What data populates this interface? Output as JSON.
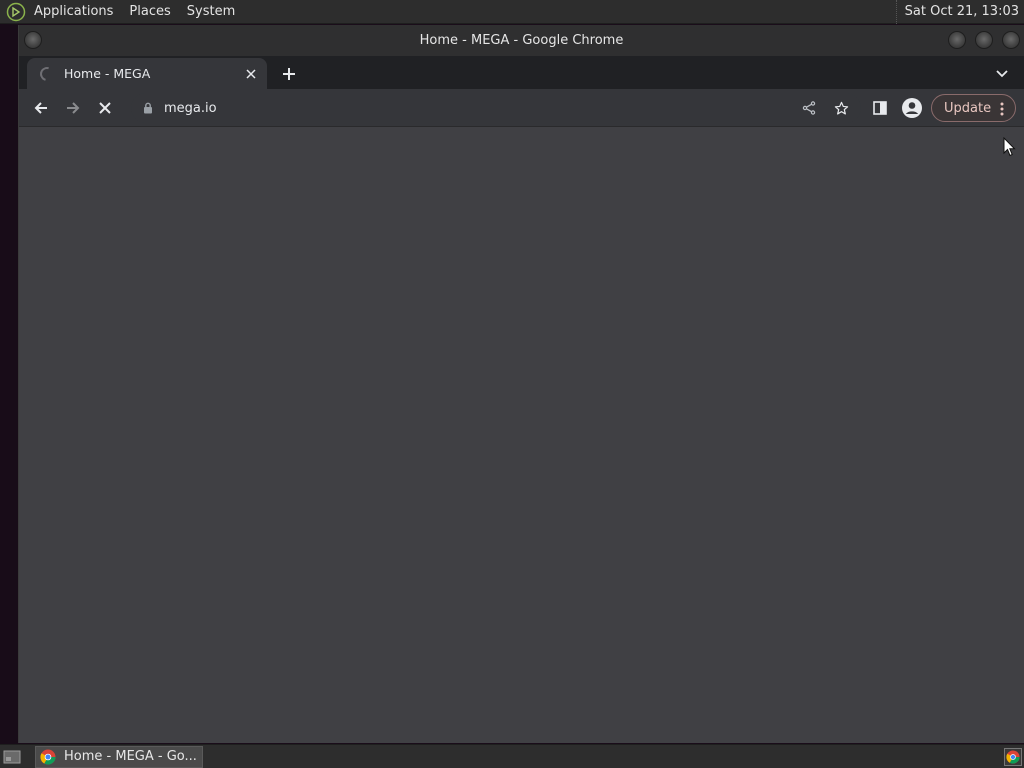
{
  "top_panel": {
    "menu": [
      "Applications",
      "Places",
      "System"
    ],
    "clock": "Sat Oct 21, 13:03"
  },
  "window": {
    "title": "Home - MEGA - Google Chrome"
  },
  "browser": {
    "tab": {
      "title": "Home - MEGA",
      "loading": true
    },
    "url": "mega.io",
    "update_label": "Update"
  },
  "taskbar": {
    "task_label": "Home - MEGA - Go..."
  },
  "colors": {
    "content_bg": "#404044",
    "toolbar_bg": "#35363a",
    "update_border": "#8a6b6b"
  },
  "icons": {
    "back": "arrow-left-icon",
    "forward": "arrow-right-icon",
    "stop": "close-x-icon",
    "lock": "lock-icon",
    "share": "share-icon",
    "bookmark": "star-icon",
    "side_panel": "side-panel-icon",
    "profile": "profile-icon",
    "menu": "kebab-icon"
  }
}
